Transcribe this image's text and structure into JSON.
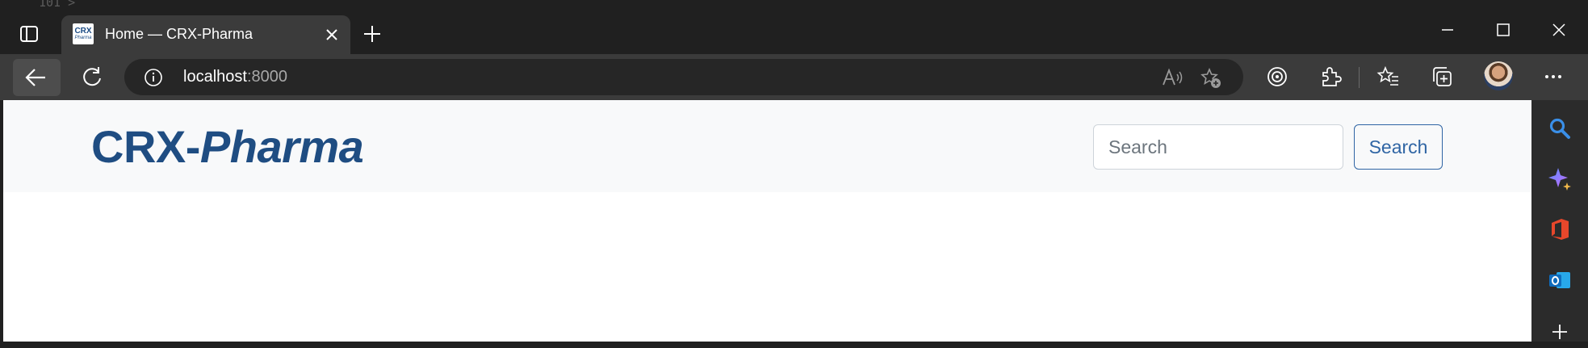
{
  "tabstrip": {
    "peek_text": "101 >",
    "tab": {
      "title": "Home — CRX-Pharma",
      "favicon_top": "CRX",
      "favicon_bottom": "Pharma"
    }
  },
  "toolbar": {
    "url_host": "localhost",
    "url_port": ":8000",
    "icons": [
      "back-icon",
      "refresh-icon",
      "info-icon",
      "read-aloud-icon",
      "add-favorite-icon",
      "tracking-icon",
      "extensions-icon",
      "favorites-icon",
      "collections-icon",
      "profile-avatar",
      "more-icon"
    ]
  },
  "page": {
    "brand_a": "CRX-",
    "brand_b": "Pharma",
    "search": {
      "placeholder": "Search",
      "button_label": "Search"
    },
    "colors": {
      "brand": "#1f4d82",
      "navbar_bg": "#f8f9fa",
      "button_outline": "#2f65a4"
    }
  },
  "sidebar": {
    "icons": [
      "search-icon",
      "copilot-icon",
      "office-icon",
      "outlook-icon",
      "add-icon"
    ]
  }
}
